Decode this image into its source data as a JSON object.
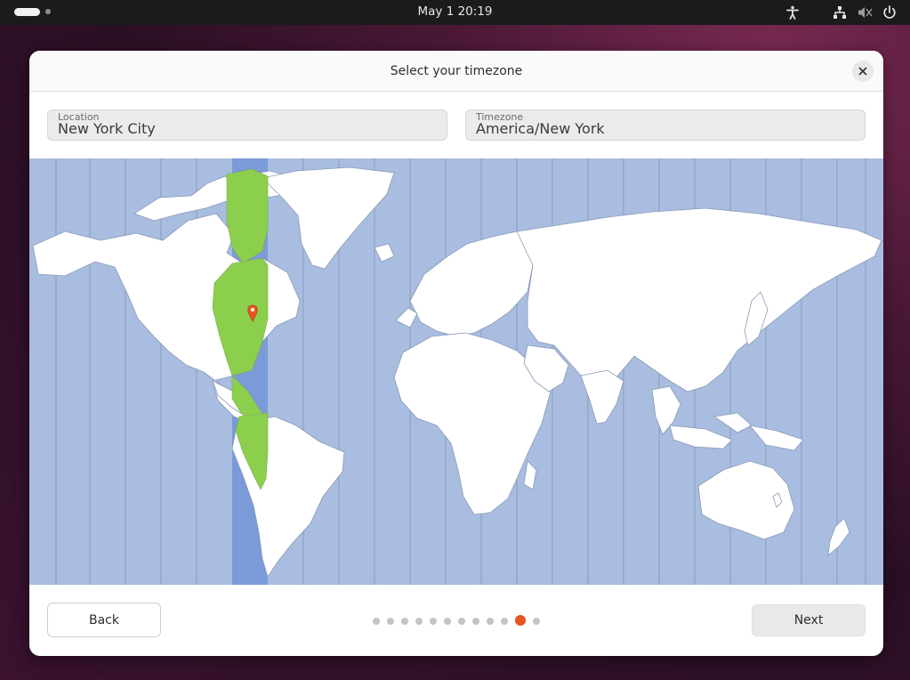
{
  "topbar": {
    "clock": "May 1  20:19",
    "icons": [
      "accessibility-icon",
      "network-icon",
      "volume-muted-icon",
      "power-icon"
    ]
  },
  "dialog": {
    "title": "Select your timezone",
    "location_label": "Location",
    "location_value": "New York City",
    "timezone_label": "Timezone",
    "timezone_value": "America/New York",
    "back_label": "Back",
    "next_label": "Next",
    "progress": {
      "total_steps": 12,
      "current_step": 11
    }
  },
  "colors": {
    "accent": "#e95420",
    "ocean": "#a8bde0",
    "land": "#ffffff",
    "selected_zone_land": "#8ccf4d",
    "selected_zone_ocean": "#7b9ad8"
  }
}
